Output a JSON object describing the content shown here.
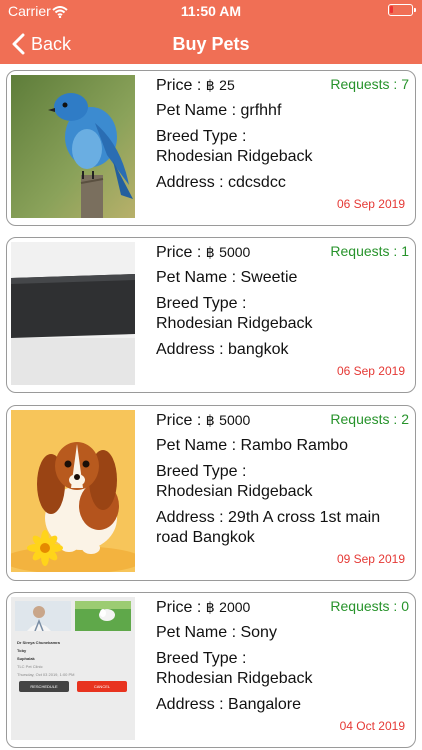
{
  "status_bar": {
    "carrier": "Carrier",
    "time": "11:50 AM"
  },
  "nav": {
    "back_label": "Back",
    "title": "Buy Pets"
  },
  "listings": [
    {
      "requests": "Requests : 7",
      "price_label": "Price : ",
      "currency": "฿",
      "price": "25",
      "pet_name": "Pet Name : grfhhf",
      "breed_label": "Breed Type :",
      "breed": "Rhodesian Ridgeback",
      "address": "Address : cdcsdcc",
      "date": "06 Sep 2019"
    },
    {
      "requests": "Requests : 1",
      "price_label": "Price : ",
      "currency": "฿",
      "price": "5000",
      "pet_name": "Pet Name : Sweetie",
      "breed_label": "Breed Type :",
      "breed": "Rhodesian Ridgeback",
      "address": "Address : bangkok",
      "date": "06 Sep 2019"
    },
    {
      "requests": "Requests : 2",
      "price_label": "Price : ",
      "currency": "฿",
      "price": "5000",
      "pet_name": "Pet Name : Rambo Rambo",
      "breed_label": "Breed Type :",
      "breed": "Rhodesian Ridgeback",
      "address": "Address : 29th A cross 1st main",
      "address_line2": "road Bangkok",
      "date": "09 Sep 2019"
    },
    {
      "requests": "Requests : 0",
      "price_label": "Price : ",
      "currency": "฿",
      "price": "2000",
      "pet_name": "Pet Name : Sony",
      "breed_label": "Breed Type :",
      "breed": "Rhodesian Ridgeback",
      "address": "Address : Bangalore",
      "date": "04 Oct 2019",
      "thumbnail": {
        "doctor": "Dr Sireya Chunekamra",
        "pet": "Toby",
        "owner": "Suphalak",
        "clinic": "TLC Pet Clinic",
        "datetime": "Thursday, Oct 03 2019, 1:00 PM",
        "reschedule_label": "RESCHEDULE",
        "cancel_label": "CANCEL"
      }
    }
  ]
}
